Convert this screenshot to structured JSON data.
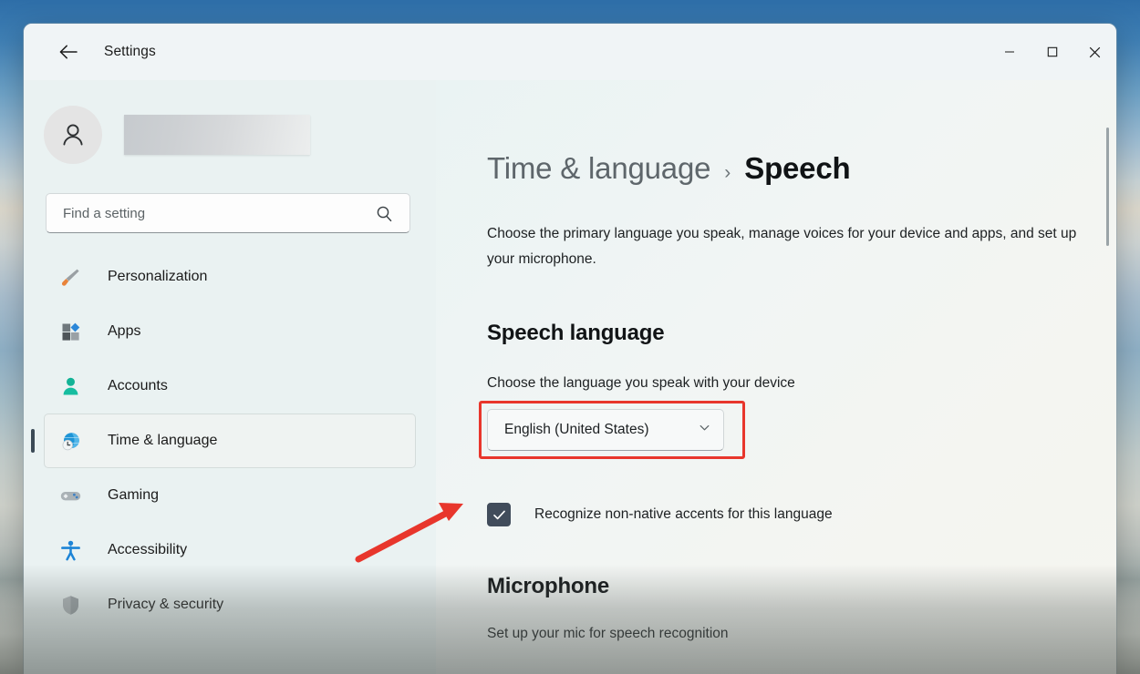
{
  "window": {
    "app_title": "Settings",
    "back_icon": "back-arrow-icon",
    "controls": {
      "minimize": "minimize-icon",
      "maximize": "maximize-icon",
      "close": "close-icon"
    }
  },
  "sidebar": {
    "account": {
      "avatar_icon": "person-avatar-icon",
      "username_redacted": ""
    },
    "search": {
      "placeholder": "Find a setting",
      "value": "",
      "icon": "search-icon"
    },
    "items": [
      {
        "label": "Personalization",
        "icon": "paintbrush-icon",
        "selected": false
      },
      {
        "label": "Apps",
        "icon": "apps-grid-icon",
        "selected": false
      },
      {
        "label": "Accounts",
        "icon": "account-person-icon",
        "selected": false
      },
      {
        "label": "Time & language",
        "icon": "globe-clock-icon",
        "selected": true
      },
      {
        "label": "Gaming",
        "icon": "gamepad-icon",
        "selected": false
      },
      {
        "label": "Accessibility",
        "icon": "accessibility-icon",
        "selected": false
      },
      {
        "label": "Privacy & security",
        "icon": "shield-icon",
        "selected": false
      }
    ]
  },
  "main": {
    "breadcrumb": {
      "parent": "Time & language",
      "separator": "›",
      "current": "Speech"
    },
    "description": "Choose the primary language you speak, manage voices for your device and apps, and set up your microphone.",
    "speech_language": {
      "heading": "Speech language",
      "field_label": "Choose the language you speak with your device",
      "dropdown_value": "English (United States)",
      "dropdown_icon": "chevron-down-icon",
      "checkbox_label": "Recognize non-native accents for this language",
      "checkbox_checked": true
    },
    "microphone": {
      "heading": "Microphone",
      "description": "Set up your mic for speech recognition"
    }
  },
  "annotations": {
    "highlight_color": "#e8362c",
    "arrow_color": "#e8362c",
    "highlight_target": "speech-language-dropdown",
    "arrow_target": "recognize-accents-checkbox"
  },
  "colors": {
    "window_bg": "#f3f6f7",
    "sidebar_bg": "#eaf2f2",
    "content_bg": "#f1f5f4",
    "selected_item_bg": "#eff3f2",
    "selection_bar": "#3b4a56",
    "checkbox_fill": "#414c5b",
    "text_primary": "#1b1b1b",
    "text_secondary": "#5e666b"
  }
}
